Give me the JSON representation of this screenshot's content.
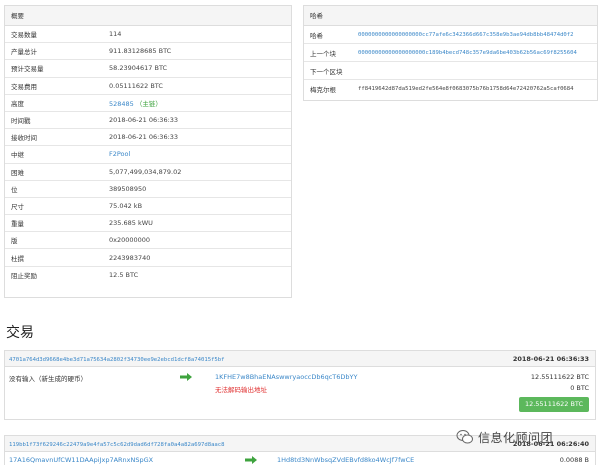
{
  "summary": {
    "title": "概要",
    "rows": [
      {
        "label": "交易数量",
        "value": "114"
      },
      {
        "label": "产量总计",
        "value": "911.83128685 BTC"
      },
      {
        "label": "预计交易量",
        "value": "58.23904617 BTC"
      },
      {
        "label": "交易费用",
        "value": "0.05111622 BTC"
      },
      {
        "label": "高度",
        "value": "528485",
        "suffix": "（主链）"
      },
      {
        "label": "时间戳",
        "value": "2018-06-21 06:36:33"
      },
      {
        "label": "接收时间",
        "value": "2018-06-21 06:36:33"
      },
      {
        "label": "中继",
        "value": "F2Pool"
      },
      {
        "label": "困难",
        "value": "5,077,499,034,879.02"
      },
      {
        "label": "位",
        "value": "389508950"
      },
      {
        "label": "尺寸",
        "value": "75.042 kB"
      },
      {
        "label": "重量",
        "value": "235.685 kWU"
      },
      {
        "label": "版",
        "value": "0x20000000"
      },
      {
        "label": "杜撰",
        "value": "2243983740"
      },
      {
        "label": "阻止奖励",
        "value": "12.5 BTC"
      }
    ]
  },
  "hashes": {
    "title": "哈希",
    "rows": [
      {
        "label": "哈希",
        "value": "0000000000000000000cc77afe6c342366d667c358e9b3ae94db8bb48474d0f2"
      },
      {
        "label": "上一个块",
        "value": "00000000000000000000c189b4becd748c357e9da6be403b62b56ac69f8255604"
      },
      {
        "label": "下一个区块",
        "value": ""
      },
      {
        "label": "梅克尔根",
        "value": "ff8419642d87da519ed2fe564e8f0683075b76b1758d64e72420762a5caf0684"
      }
    ]
  },
  "transactions_title": "交易",
  "transactions": [
    {
      "hash": "4701a764d3d9668e4be3d71a75634a2802f34730ee9e2ebcd1dcf8a74015f5bf",
      "date": "2018-06-21 06:36:33",
      "input": "没有输入（新生成的硬币）",
      "output_address": "1KFHE7w8BhaENAswwryaoccDb6qcT6DbYY",
      "output_note": "无法解码输出地址",
      "amount1": "12.55111622 BTC",
      "amount2": "0 BTC",
      "total": "12.55111622 BTC"
    },
    {
      "hash": "119bb1f73f629246c22479a9e4fa57c5c62d9dad6df728fa0a4a82a697d8aac8",
      "date": "2018-06-21 06:26:40",
      "input": "17A16QmavnUfCW11DAApiJxp7ARnxNSpGX",
      "output_address": "1Hd8td3NnWbsqZVdEBvfd8ko4WcJf7fwCE",
      "amount1": "0.0088 B"
    }
  ],
  "watermark": {
    "text": "信息化顾问团"
  },
  "colors": {
    "link": "#3a87c8",
    "green": "#5cb85c",
    "red": "#e03030",
    "arrow": "#3ea33e"
  }
}
